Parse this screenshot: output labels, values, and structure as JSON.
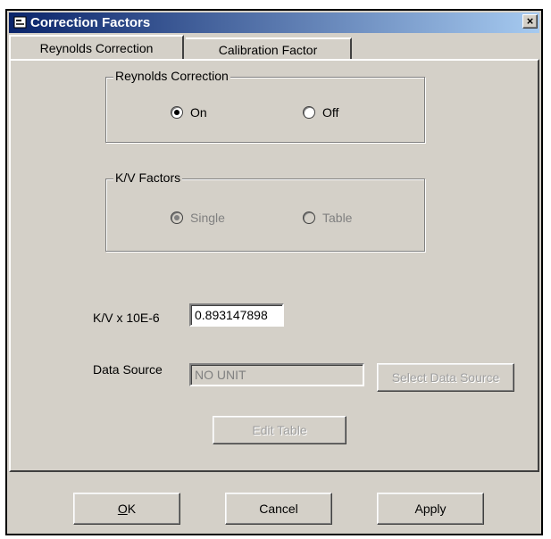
{
  "window": {
    "title": "Correction Factors",
    "close_label": "×"
  },
  "tabs": [
    {
      "label": "Reynolds Correction",
      "active": true
    },
    {
      "label": "Calibration Factor",
      "active": false
    }
  ],
  "reynolds_group": {
    "label": "Reynolds Correction",
    "options": [
      {
        "label": "On",
        "checked": true
      },
      {
        "label": "Off",
        "checked": false
      }
    ]
  },
  "kv_group": {
    "label": "K/V Factors",
    "enabled": false,
    "options": [
      {
        "label": "Single",
        "checked": true
      },
      {
        "label": "Table",
        "checked": false
      }
    ]
  },
  "kv_field": {
    "label": "K/V x 10E-6",
    "value": "0.893147898"
  },
  "data_source": {
    "label": "Data Source",
    "value": "NO UNIT",
    "button_label": "Select Data Source"
  },
  "edit_table_label": "Edit Table",
  "footer": {
    "ok_accel": "O",
    "ok_rest": "K",
    "cancel_label": "Cancel",
    "apply_label": "Apply"
  },
  "colors": {
    "titlebar_start": "#0a246a",
    "titlebar_end": "#a6caf0",
    "face": "#d4d0c8"
  }
}
